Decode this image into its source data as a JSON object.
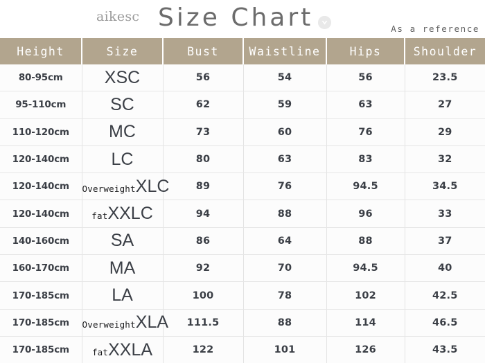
{
  "header": {
    "brand": "aikesc",
    "title": "Size Chart",
    "badge_icon": "chevron-down-circle-icon",
    "reference_note": "As a reference"
  },
  "table": {
    "columns": [
      "Height",
      "Size",
      "Bust",
      "Waistline",
      "Hips",
      "Shoulder"
    ],
    "rows": [
      {
        "height": "80-95cm",
        "qualifier": "",
        "size": "XSC",
        "bust": "56",
        "waistline": "54",
        "hips": "56",
        "shoulder": "23.5"
      },
      {
        "height": "95-110cm",
        "qualifier": "",
        "size": "SC",
        "bust": "62",
        "waistline": "59",
        "hips": "63",
        "shoulder": "27"
      },
      {
        "height": "110-120cm",
        "qualifier": "",
        "size": "MC",
        "bust": "73",
        "waistline": "60",
        "hips": "76",
        "shoulder": "29"
      },
      {
        "height": "120-140cm",
        "qualifier": "",
        "size": "LC",
        "bust": "80",
        "waistline": "63",
        "hips": "83",
        "shoulder": "32"
      },
      {
        "height": "120-140cm",
        "qualifier": "Overweight",
        "size": "XLC",
        "bust": "89",
        "waistline": "76",
        "hips": "94.5",
        "shoulder": "34.5"
      },
      {
        "height": "120-140cm",
        "qualifier": "fat",
        "size": "XXLC",
        "bust": "94",
        "waistline": "88",
        "hips": "96",
        "shoulder": "33"
      },
      {
        "height": "140-160cm",
        "qualifier": "",
        "size": "SA",
        "bust": "86",
        "waistline": "64",
        "hips": "88",
        "shoulder": "37"
      },
      {
        "height": "160-170cm",
        "qualifier": "",
        "size": "MA",
        "bust": "92",
        "waistline": "70",
        "hips": "94.5",
        "shoulder": "40"
      },
      {
        "height": "170-185cm",
        "qualifier": "",
        "size": "LA",
        "bust": "100",
        "waistline": "78",
        "hips": "102",
        "shoulder": "42.5"
      },
      {
        "height": "170-185cm",
        "qualifier": "Overweight",
        "size": "XLA",
        "bust": "111.5",
        "waistline": "88",
        "hips": "114",
        "shoulder": "46.5"
      },
      {
        "height": "170-185cm",
        "qualifier": "fat",
        "size": "XXLA",
        "bust": "122",
        "waistline": "101",
        "hips": "126",
        "shoulder": "43.5"
      }
    ]
  },
  "colors": {
    "header_background": "#b2a58e",
    "header_text": "#ffffff",
    "page_background": "#ffffff",
    "cell_background": "#fcfcfc",
    "title_text": "#6c6c6c",
    "brand_text": "#9a9a9a",
    "grid_line": "#e3e3e3"
  }
}
